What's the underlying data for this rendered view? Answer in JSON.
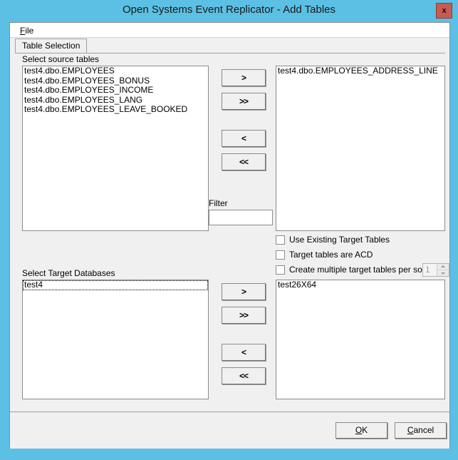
{
  "window": {
    "title": "Open Systems Event Replicator - Add Tables",
    "close_label": "x",
    "accent_color": "#5bc0e4",
    "close_color": "#c75b52",
    "client_color": "#f0f0f0"
  },
  "menu": {
    "items": [
      {
        "label": "File",
        "accel": "F"
      }
    ]
  },
  "tabs": [
    {
      "label": "Table Selection",
      "selected": true
    }
  ],
  "source_section": {
    "label": "Select source tables",
    "items": [
      "test4.dbo.EMPLOYEES",
      "test4.dbo.EMPLOYEES_BONUS",
      "test4.dbo.EMPLOYEES_INCOME",
      "test4.dbo.EMPLOYEES_LANG",
      "test4.dbo.EMPLOYEES_LEAVE_BOOKED"
    ]
  },
  "source_transfer_buttons": [
    {
      "label": ">",
      "name": "move-right-button"
    },
    {
      "label": ">>",
      "name": "move-all-right-button"
    },
    {
      "label": "<",
      "name": "move-left-button"
    },
    {
      "label": "<<",
      "name": "move-all-left-button"
    }
  ],
  "filter": {
    "label": "Filter",
    "value": "",
    "placeholder": ""
  },
  "selected_tables": {
    "items": [
      "test4.dbo.EMPLOYEES_ADDRESS_LINE"
    ]
  },
  "options": [
    {
      "label": "Use Existing Target Tables",
      "checked": false
    },
    {
      "label": "Target tables are ACD",
      "checked": false
    },
    {
      "label": "Create multiple target tables per source",
      "checked": false
    }
  ],
  "multiplier": {
    "value": "1",
    "enabled": false
  },
  "target_section": {
    "label": "Select Target Databases",
    "items": [
      {
        "text": "test4",
        "focused": true
      }
    ]
  },
  "target_transfer_buttons": [
    {
      "label": ">",
      "name": "target-move-right-button"
    },
    {
      "label": ">>",
      "name": "target-move-all-right-button"
    },
    {
      "label": "<",
      "name": "target-move-left-button"
    },
    {
      "label": "<<",
      "name": "target-move-all-left-button"
    }
  ],
  "selected_databases": {
    "items": [
      "test26X64"
    ]
  },
  "footer": {
    "ok": {
      "label": "OK",
      "accel": "O"
    },
    "cancel": {
      "label": "Cancel",
      "accel": "C"
    }
  }
}
